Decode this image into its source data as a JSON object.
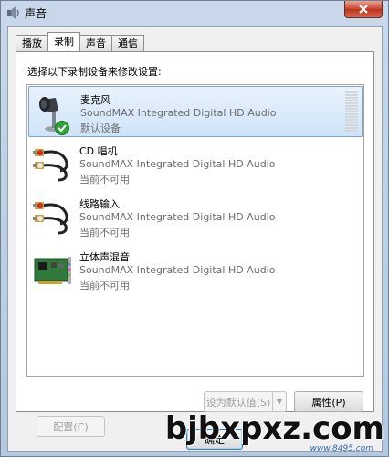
{
  "window": {
    "title": "声音",
    "title_icon": "speaker-icon",
    "close_icon": "close-icon"
  },
  "tabs": [
    {
      "label": "播放",
      "active": false
    },
    {
      "label": "录制",
      "active": true
    },
    {
      "label": "声音",
      "active": false
    },
    {
      "label": "通信",
      "active": false
    }
  ],
  "instruction": "选择以下录制设备来修改设置:",
  "devices": [
    {
      "name": "麦克风",
      "driver": "SoundMAX Integrated Digital HD Audio",
      "status": "默认设备",
      "icon": "microphone-icon",
      "badge": "default-check-icon",
      "selected": true,
      "level": 0
    },
    {
      "name": "CD 唱机",
      "driver": "SoundMAX Integrated Digital HD Audio",
      "status": "当前不可用",
      "icon": "rca-cable-icon",
      "selected": false
    },
    {
      "name": "线路输入",
      "driver": "SoundMAX Integrated Digital HD Audio",
      "status": "当前不可用",
      "icon": "rca-cable-icon",
      "selected": false
    },
    {
      "name": "立体声混音",
      "driver": "SoundMAX Integrated Digital HD Audio",
      "status": "当前不可用",
      "icon": "sound-card-icon",
      "selected": false
    }
  ],
  "buttons": {
    "configure": "配置(C)",
    "set_default": "设为默认值(S)",
    "properties": "属性(P)",
    "ok": "确定"
  },
  "watermark": {
    "text": "bjbxpxz.com",
    "sub": "www.8495.com"
  },
  "colors": {
    "selection": "#cfe4f8",
    "selection_border": "#7da2ce",
    "accent": "#3c7fb1"
  }
}
